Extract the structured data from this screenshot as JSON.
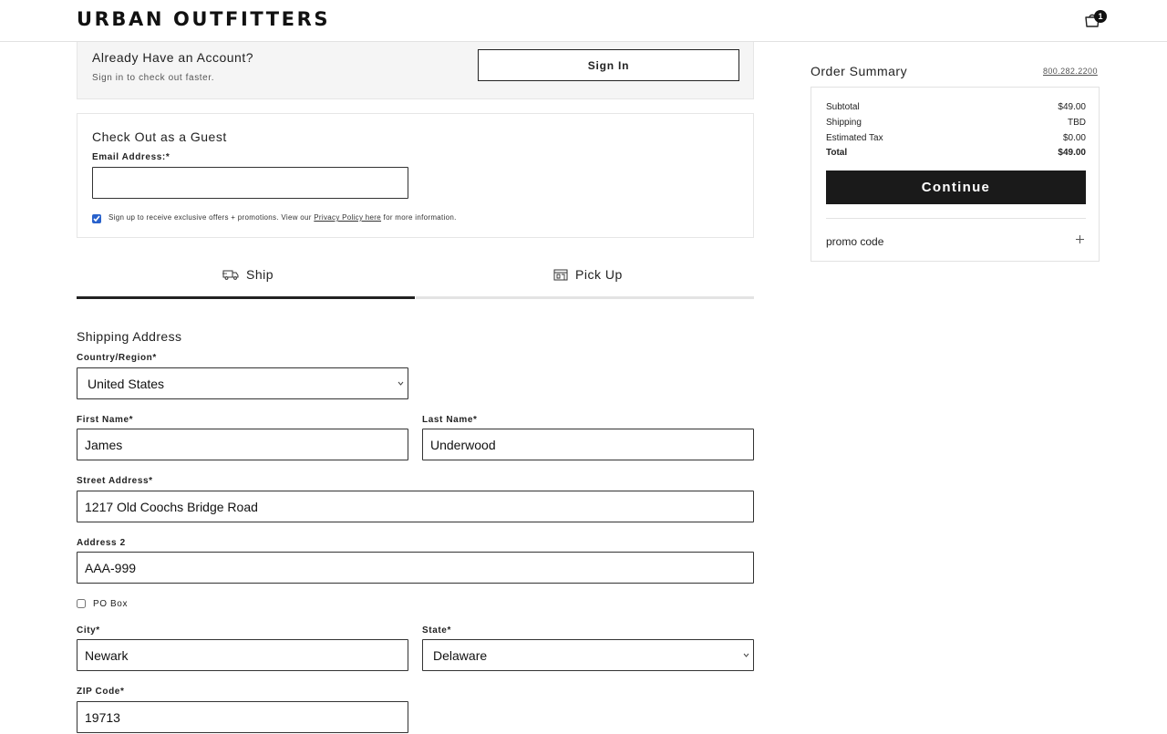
{
  "header": {
    "logo": "URBAN OUTFITTERS",
    "cart_count": "1"
  },
  "account": {
    "title": "Already Have an Account?",
    "subtitle": "Sign in to check out faster.",
    "signin_label": "Sign In"
  },
  "guest": {
    "title": "Check Out as a Guest",
    "email_label": "Email Address:*",
    "email_value": "",
    "offers_checked": true,
    "offers_text_before": "Sign up to receive exclusive offers + promotions. View our ",
    "offers_link": "Privacy Policy here",
    "offers_text_after": " for more information."
  },
  "tabs": [
    {
      "label": "Ship",
      "icon": "truck-icon",
      "active": true
    },
    {
      "label": "Pick Up",
      "icon": "store-icon",
      "active": false
    }
  ],
  "shipping": {
    "title": "Shipping Address",
    "country_label": "Country/Region*",
    "country_value": "United States",
    "first_name_label": "First Name*",
    "first_name_value": "James",
    "last_name_label": "Last Name*",
    "last_name_value": "Underwood",
    "street_label": "Street Address*",
    "street_value": "1217 Old Coochs Bridge Road",
    "address2_label": "Address 2",
    "address2_value": "AAA-999",
    "po_box_label": "PO Box",
    "po_box_checked": false,
    "city_label": "City*",
    "city_value": "Newark",
    "state_label": "State*",
    "state_value": "Delaware",
    "zip_label": "ZIP Code*",
    "zip_value": "19713"
  },
  "summary": {
    "title": "Order Summary",
    "phone": "800.282.2200",
    "subtotal_label": "Subtotal",
    "subtotal_value": "$49.00",
    "shipping_label": "Shipping",
    "shipping_value": "TBD",
    "tax_label": "Estimated Tax",
    "tax_value": "$0.00",
    "total_label": "Total",
    "total_value": "$49.00",
    "continue_label": "Continue",
    "promo_label": "promo code"
  }
}
